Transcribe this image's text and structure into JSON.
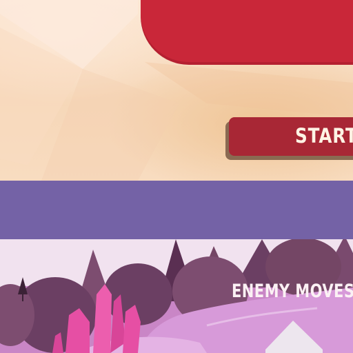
{
  "menu": {
    "start_label": "START"
  },
  "tutorial": {
    "hint_label": "ENEMY MOVES",
    "arrow_icon": "up-arrow-icon"
  },
  "colors": {
    "banner_red": "#c92739",
    "button_red": "#a82735",
    "parchment": "#f6dcc0",
    "band_purple": "#7462a6",
    "ground_pink": "#d79ad9",
    "tree_dark": "#6b3f63",
    "crystal_pink": "#e64fa4"
  }
}
